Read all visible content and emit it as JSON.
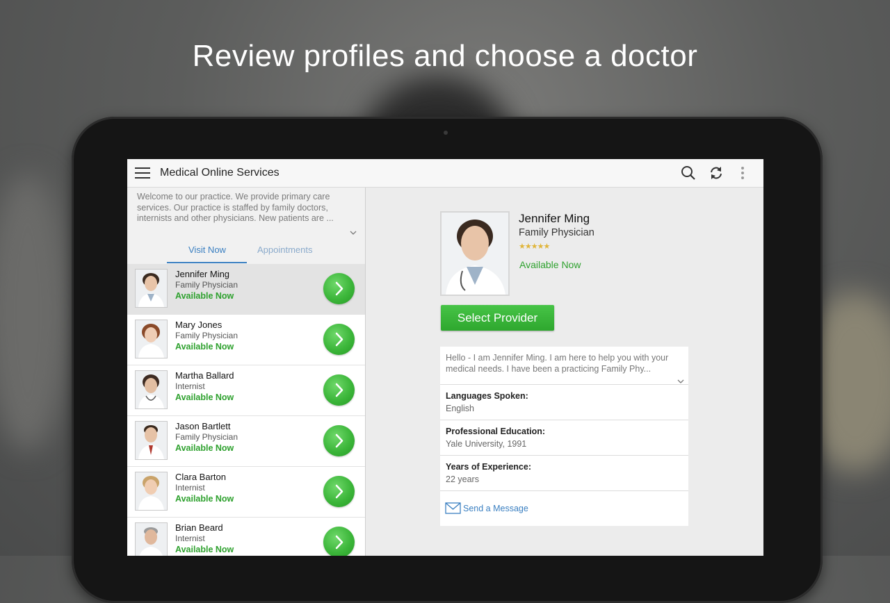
{
  "headline": "Review profiles and choose a doctor",
  "appbar": {
    "title": "Medical Online Services",
    "icons": [
      "menu-icon",
      "search-icon",
      "refresh-icon",
      "overflow-menu-icon"
    ]
  },
  "welcome_text": "Welcome to our practice. We provide primary care services. Our practice is staffed by family doctors, internists and other physicians. New patients are ...",
  "tabs": [
    {
      "label": "Visit Now",
      "active": true
    },
    {
      "label": "Appointments",
      "active": false
    }
  ],
  "providers": [
    {
      "name": "Jennifer Ming",
      "specialty": "Family Physician",
      "status": "Available Now",
      "selected": true
    },
    {
      "name": "Mary Jones",
      "specialty": "Family Physician",
      "status": "Available Now"
    },
    {
      "name": "Martha Ballard",
      "specialty": "Internist",
      "status": "Available Now"
    },
    {
      "name": "Jason Bartlett",
      "specialty": "Family Physician",
      "status": "Available Now"
    },
    {
      "name": "Clara Barton",
      "specialty": "Internist",
      "status": "Available Now"
    },
    {
      "name": "Brian Beard",
      "specialty": "Internist",
      "status": "Available Now"
    }
  ],
  "detail": {
    "name": "Jennifer Ming",
    "specialty": "Family Physician",
    "rating": 5,
    "stars": "★★★★★",
    "status": "Available Now",
    "select_label": "Select Provider",
    "bio": "Hello - I am Jennifer Ming. I am here to help you with your medical needs. I have been a practicing Family Phy...",
    "languages_label": "Languages Spoken:",
    "languages_value": "English",
    "education_label": "Professional Education:",
    "education_value": "Yale University, 1991",
    "experience_label": "Years of Experience:",
    "experience_value": "22 years",
    "message_label": "Send a Message"
  },
  "colors": {
    "accent_blue": "#3a7fc1",
    "available_green": "#2ea12e",
    "button_green": "#3cb63a",
    "star_gold": "#e0b53a"
  }
}
